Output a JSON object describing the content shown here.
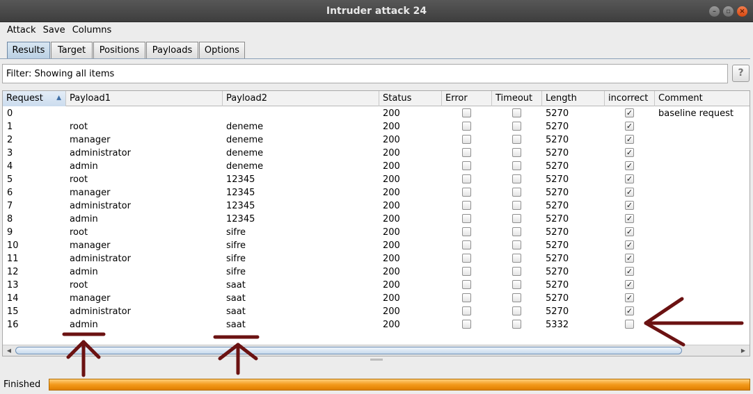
{
  "window": {
    "title": "Intruder attack 24"
  },
  "menu": [
    "Attack",
    "Save",
    "Columns"
  ],
  "tabs": [
    "Results",
    "Target",
    "Positions",
    "Payloads",
    "Options"
  ],
  "filter": {
    "text": "Filter: Showing all items",
    "help": "?"
  },
  "table": {
    "columns": [
      "Request",
      "Payload1",
      "Payload2",
      "Status",
      "Error",
      "Timeout",
      "Length",
      "incorrect",
      "Comment"
    ],
    "rows": [
      {
        "request": "0",
        "payload1": "",
        "payload2": "",
        "status": "200",
        "error": false,
        "timeout": false,
        "length": "5270",
        "incorrect": true,
        "comment": "baseline request"
      },
      {
        "request": "1",
        "payload1": "root",
        "payload2": "deneme",
        "status": "200",
        "error": false,
        "timeout": false,
        "length": "5270",
        "incorrect": true,
        "comment": ""
      },
      {
        "request": "2",
        "payload1": "manager",
        "payload2": "deneme",
        "status": "200",
        "error": false,
        "timeout": false,
        "length": "5270",
        "incorrect": true,
        "comment": ""
      },
      {
        "request": "3",
        "payload1": "administrator",
        "payload2": "deneme",
        "status": "200",
        "error": false,
        "timeout": false,
        "length": "5270",
        "incorrect": true,
        "comment": ""
      },
      {
        "request": "4",
        "payload1": "admin",
        "payload2": "deneme",
        "status": "200",
        "error": false,
        "timeout": false,
        "length": "5270",
        "incorrect": true,
        "comment": ""
      },
      {
        "request": "5",
        "payload1": "root",
        "payload2": "12345",
        "status": "200",
        "error": false,
        "timeout": false,
        "length": "5270",
        "incorrect": true,
        "comment": ""
      },
      {
        "request": "6",
        "payload1": "manager",
        "payload2": "12345",
        "status": "200",
        "error": false,
        "timeout": false,
        "length": "5270",
        "incorrect": true,
        "comment": ""
      },
      {
        "request": "7",
        "payload1": "administrator",
        "payload2": "12345",
        "status": "200",
        "error": false,
        "timeout": false,
        "length": "5270",
        "incorrect": true,
        "comment": ""
      },
      {
        "request": "8",
        "payload1": "admin",
        "payload2": "12345",
        "status": "200",
        "error": false,
        "timeout": false,
        "length": "5270",
        "incorrect": true,
        "comment": ""
      },
      {
        "request": "9",
        "payload1": "root",
        "payload2": "sifre",
        "status": "200",
        "error": false,
        "timeout": false,
        "length": "5270",
        "incorrect": true,
        "comment": ""
      },
      {
        "request": "10",
        "payload1": "manager",
        "payload2": "sifre",
        "status": "200",
        "error": false,
        "timeout": false,
        "length": "5270",
        "incorrect": true,
        "comment": ""
      },
      {
        "request": "11",
        "payload1": "administrator",
        "payload2": "sifre",
        "status": "200",
        "error": false,
        "timeout": false,
        "length": "5270",
        "incorrect": true,
        "comment": ""
      },
      {
        "request": "12",
        "payload1": "admin",
        "payload2": "sifre",
        "status": "200",
        "error": false,
        "timeout": false,
        "length": "5270",
        "incorrect": true,
        "comment": ""
      },
      {
        "request": "13",
        "payload1": "root",
        "payload2": "saat",
        "status": "200",
        "error": false,
        "timeout": false,
        "length": "5270",
        "incorrect": true,
        "comment": ""
      },
      {
        "request": "14",
        "payload1": "manager",
        "payload2": "saat",
        "status": "200",
        "error": false,
        "timeout": false,
        "length": "5270",
        "incorrect": true,
        "comment": ""
      },
      {
        "request": "15",
        "payload1": "administrator",
        "payload2": "saat",
        "status": "200",
        "error": false,
        "timeout": false,
        "length": "5270",
        "incorrect": true,
        "comment": ""
      },
      {
        "request": "16",
        "payload1": "admin",
        "payload2": "saat",
        "status": "200",
        "error": false,
        "timeout": false,
        "length": "5332",
        "incorrect": false,
        "comment": ""
      }
    ]
  },
  "status": {
    "text": "Finished",
    "progress": 1.0
  },
  "colors": {
    "progress": "#f39a1b",
    "annotation": "#6b1212",
    "selected_tab": "#b9cfe3"
  }
}
